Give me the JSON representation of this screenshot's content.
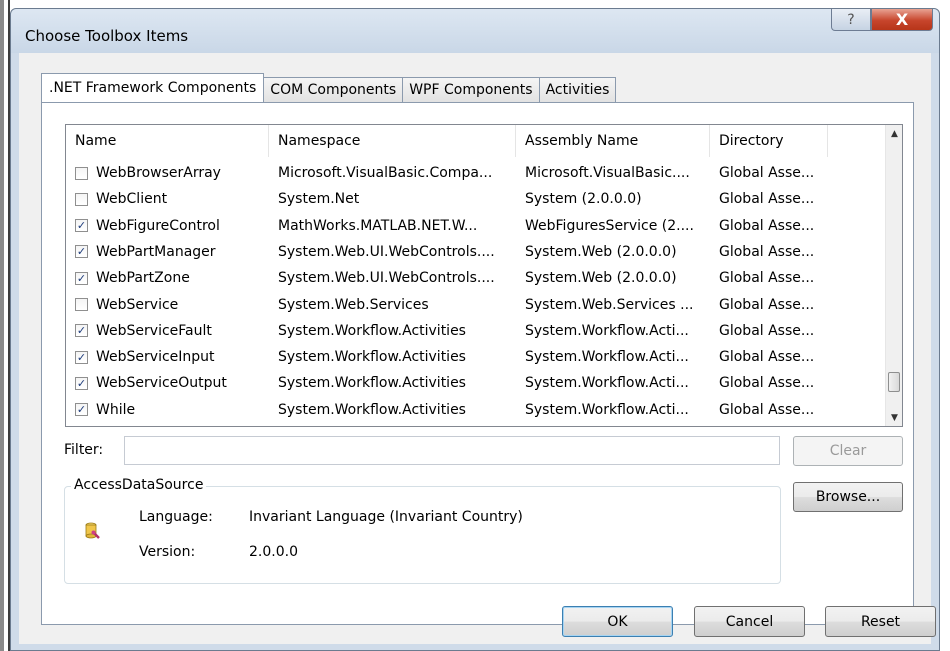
{
  "window": {
    "title": "Choose Toolbox Items",
    "help_glyph": "?",
    "close_glyph": "X"
  },
  "tabs": [
    {
      "label": ".NET Framework Components",
      "active": true
    },
    {
      "label": "COM Components",
      "active": false
    },
    {
      "label": "WPF Components",
      "active": false
    },
    {
      "label": "Activities",
      "active": false
    }
  ],
  "list": {
    "columns": [
      "Name",
      "Namespace",
      "Assembly Name",
      "Directory"
    ],
    "rows": [
      {
        "checked": false,
        "name": "WebBrowserArray",
        "namespace": "Microsoft.VisualBasic.Compa...",
        "assembly": "Microsoft.VisualBasic....",
        "directory": "Global Asse..."
      },
      {
        "checked": false,
        "name": "WebClient",
        "namespace": "System.Net",
        "assembly": "System (2.0.0.0)",
        "directory": "Global Asse..."
      },
      {
        "checked": true,
        "name": "WebFigureControl",
        "namespace": "MathWorks.MATLAB.NET.W...",
        "assembly": "WebFiguresService (2....",
        "directory": "Global Asse..."
      },
      {
        "checked": true,
        "name": "WebPartManager",
        "namespace": "System.Web.UI.WebControls....",
        "assembly": "System.Web (2.0.0.0)",
        "directory": "Global Asse..."
      },
      {
        "checked": true,
        "name": "WebPartZone",
        "namespace": "System.Web.UI.WebControls....",
        "assembly": "System.Web (2.0.0.0)",
        "directory": "Global Asse..."
      },
      {
        "checked": false,
        "name": "WebService",
        "namespace": "System.Web.Services",
        "assembly": "System.Web.Services ...",
        "directory": "Global Asse..."
      },
      {
        "checked": true,
        "name": "WebServiceFault",
        "namespace": "System.Workflow.Activities",
        "assembly": "System.Workflow.Acti...",
        "directory": "Global Asse..."
      },
      {
        "checked": true,
        "name": "WebServiceInput",
        "namespace": "System.Workflow.Activities",
        "assembly": "System.Workflow.Acti...",
        "directory": "Global Asse..."
      },
      {
        "checked": true,
        "name": "WebServiceOutput",
        "namespace": "System.Workflow.Activities",
        "assembly": "System.Workflow.Acti...",
        "directory": "Global Asse..."
      },
      {
        "checked": true,
        "name": "While",
        "namespace": "System.Workflow.Activities",
        "assembly": "System.Workflow.Acti...",
        "directory": "Global Asse..."
      }
    ],
    "check_glyph": "✓",
    "scroll_up_glyph": "▲",
    "scroll_down_glyph": "▼"
  },
  "filter": {
    "label": "Filter:",
    "value": "",
    "placeholder": ""
  },
  "buttons": {
    "clear": "Clear",
    "browse": "Browse...",
    "ok": "OK",
    "cancel": "Cancel",
    "reset": "Reset"
  },
  "details": {
    "group_title": "AccessDataSource",
    "icon": "component-icon",
    "language_label": "Language:",
    "language_value": "Invariant Language (Invariant Country)",
    "version_label": "Version:",
    "version_value": "2.0.0.0"
  }
}
